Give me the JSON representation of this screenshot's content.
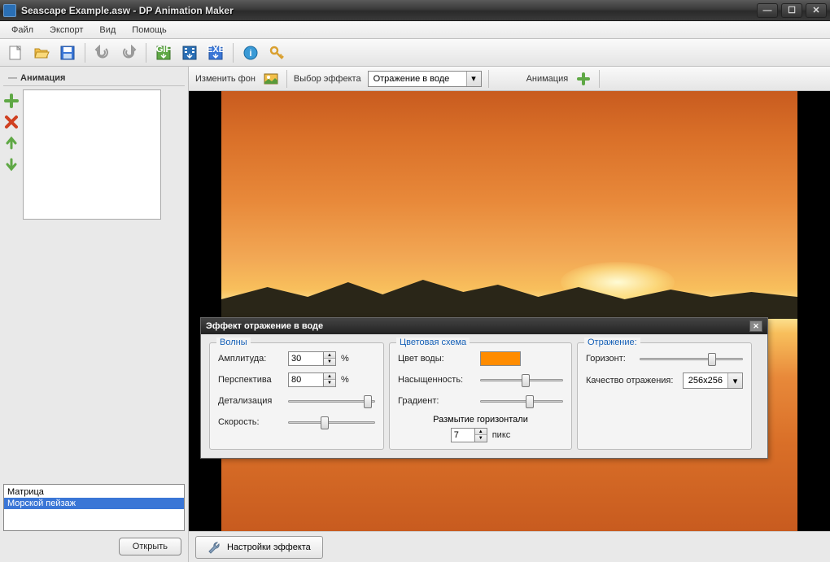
{
  "title": "Seascape Example.asw - DP Animation Maker",
  "menu": {
    "file": "Файл",
    "export": "Экспорт",
    "view": "Вид",
    "help": "Помощь"
  },
  "left_panel": {
    "title": "Анимация",
    "list": {
      "item0": "",
      "item1": "Матрица",
      "item2": "Морской пейзаж"
    },
    "open": "Открыть"
  },
  "toolbar2": {
    "change_bg": "Изменить фон",
    "select_effect": "Выбор эффекта",
    "effect_value": "Отражение в воде",
    "animation": "Анимация"
  },
  "dialog": {
    "title": "Эффект отражение в воде",
    "waves": {
      "title": "Волны",
      "amplitude_label": "Амплитуда:",
      "amplitude_value": "30",
      "amplitude_unit": "%",
      "perspective_label": "Перспектива",
      "perspective_value": "80",
      "perspective_unit": "%",
      "detail_label": "Детализация",
      "speed_label": "Скорость:"
    },
    "color": {
      "title": "Цветовая схема",
      "water_color_label": "Цвет воды:",
      "water_color": "#ff8c00",
      "saturation_label": "Насыщенность:",
      "gradient_label": "Градиент:",
      "blur_label": "Размытие горизонтали",
      "blur_value": "7",
      "blur_unit": "пикс"
    },
    "reflection": {
      "title": "Отражение:",
      "horizon_label": "Горизонт:",
      "quality_label": "Качество отражения:",
      "quality_value": "256x256"
    }
  },
  "bottom": {
    "settings": "Настройки эффекта"
  }
}
